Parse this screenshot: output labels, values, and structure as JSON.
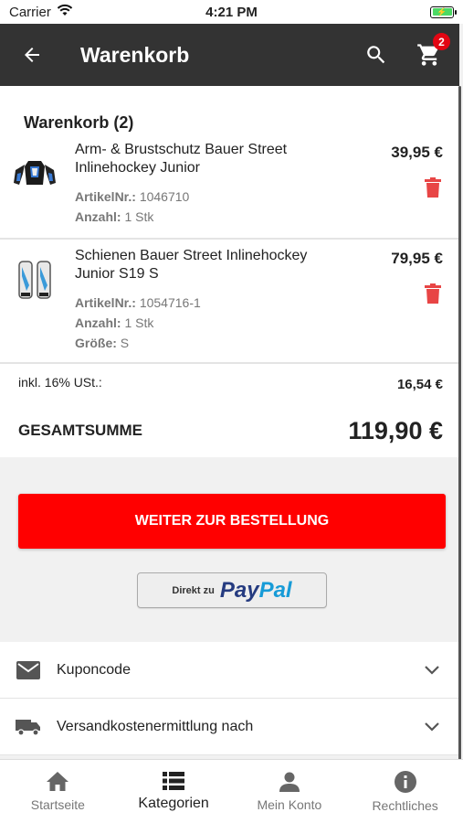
{
  "status_bar": {
    "carrier": "Carrier",
    "time": "4:21 PM"
  },
  "app_bar": {
    "title": "Warenkorb",
    "cart_count": "2"
  },
  "cart": {
    "heading": "Warenkorb (2)",
    "items": [
      {
        "name": "Arm- & Brustschutz Bauer Street Inlinehockey Junior",
        "price": "39,95 €",
        "article_label": "ArtikelNr.:",
        "article_number": "1046710",
        "quantity_label": "Anzahl:",
        "quantity": "1 Stk"
      },
      {
        "name": "Schienen Bauer Street Inlinehockey Junior S19 S",
        "price": "79,95 €",
        "article_label": "ArtikelNr.:",
        "article_number": "1054716-1",
        "quantity_label": "Anzahl:",
        "quantity": "1 Stk",
        "size_label": "Größe:",
        "size": "S"
      }
    ],
    "tax_label": "inkl. 16% USt.:",
    "tax_value": "16,54 €",
    "total_label": "GESAMTSUMME",
    "total_value": "119,90 €"
  },
  "checkout": {
    "button_label": "WEITER ZUR BESTELLUNG",
    "paypal_prefix": "Direkt zu",
    "paypal_brand_1": "Pay",
    "paypal_brand_2": "Pal"
  },
  "accordion": [
    {
      "label": "Kuponcode",
      "icon": "envelope-icon"
    },
    {
      "label": "Versandkostenermittlung nach",
      "icon": "truck-icon"
    }
  ],
  "bottom_nav": [
    {
      "label": "Startseite",
      "icon": "home-icon"
    },
    {
      "label": "Kategorien",
      "icon": "list-icon",
      "active": true
    },
    {
      "label": "Mein Konto",
      "icon": "person-icon"
    },
    {
      "label": "Rechtliches",
      "icon": "info-icon"
    }
  ],
  "colors": {
    "accent": "#ff0000",
    "appbar": "#333333",
    "trash": "#e84545",
    "badge": "#e30613"
  }
}
